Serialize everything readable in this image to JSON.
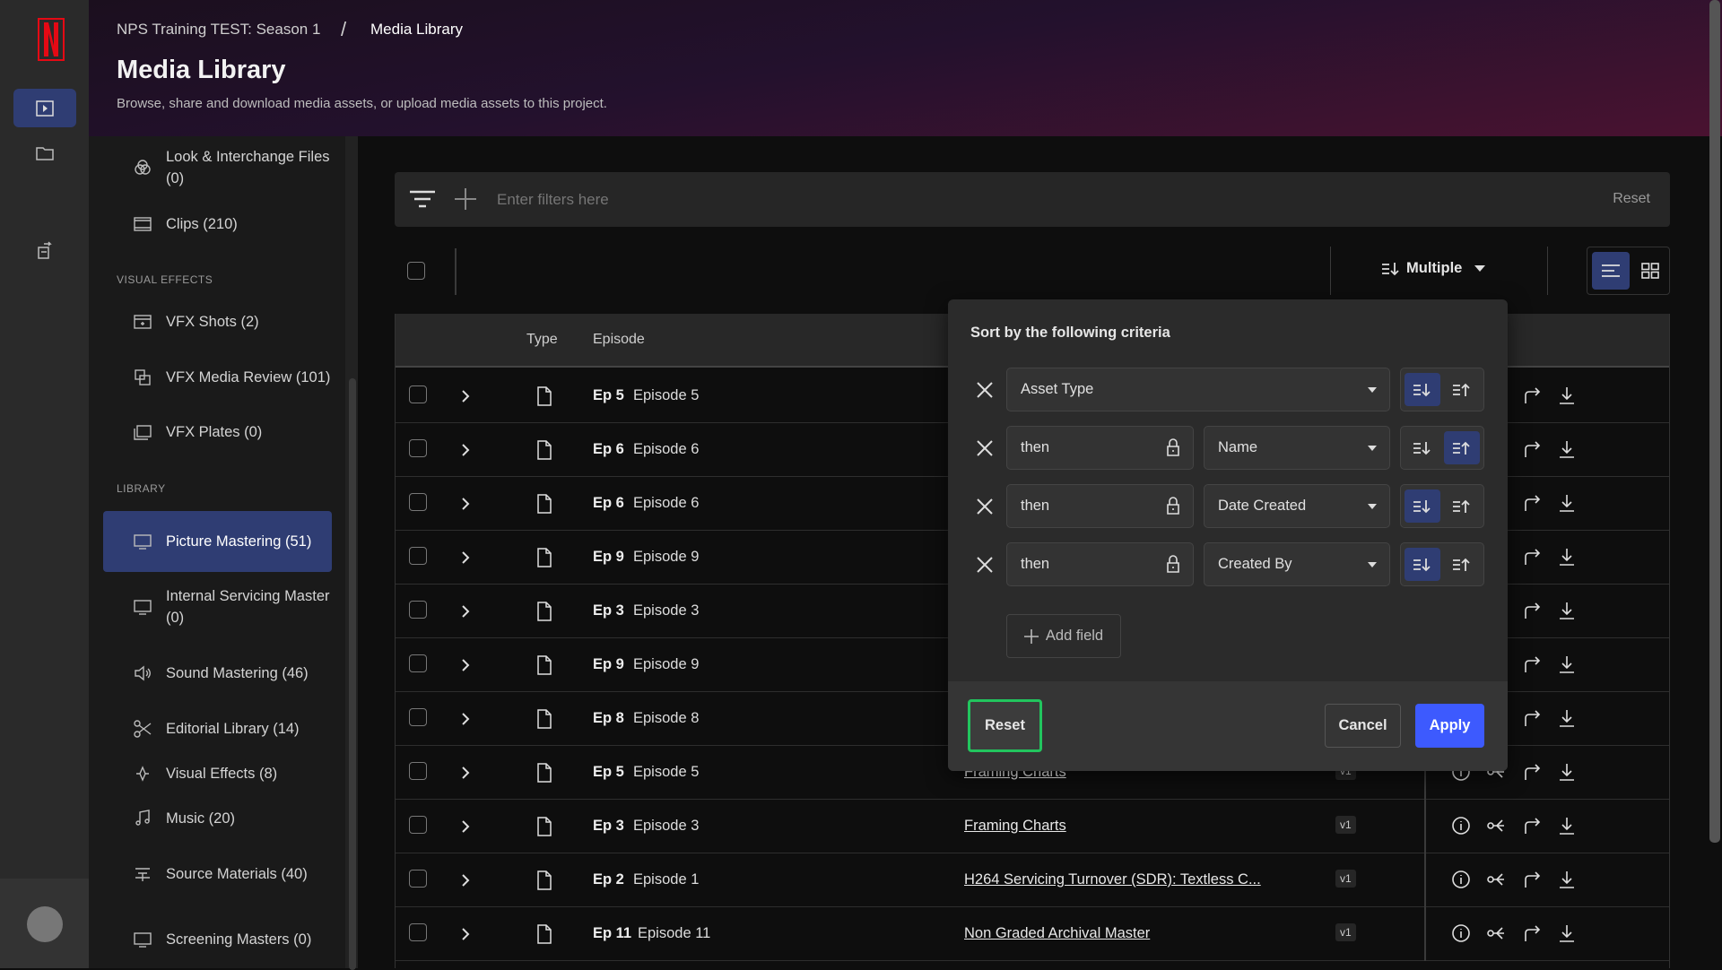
{
  "header": {
    "breadcrumb_parent": "NPS Training TEST: Season 1",
    "breadcrumb_sep": "/",
    "breadcrumb_current": "Media Library",
    "title": "Media Library",
    "subtitle": "Browse, share and download media assets, or upload media assets to this project."
  },
  "colors": {
    "accent": "#2f3d73",
    "apply": "#3d5afe",
    "focus_outline": "#22c55e",
    "brand": "#e50914"
  },
  "rail": {
    "items": [
      {
        "icon": "play-icon",
        "active": true
      },
      {
        "icon": "folder-icon"
      },
      {
        "icon": "export-icon"
      }
    ],
    "avatar": "avatar"
  },
  "sidebar": {
    "items": [
      {
        "label": "Look & Interchange Files (0)",
        "icon": "venn-icon",
        "type": "item"
      },
      {
        "label": "Clips (210)",
        "icon": "film-icon",
        "type": "item"
      },
      {
        "label": "VISUAL EFFECTS",
        "type": "section"
      },
      {
        "label": "VFX Shots (2)",
        "icon": "clapper-icon",
        "type": "item"
      },
      {
        "label": "VFX Media Review (101)",
        "icon": "review-icon",
        "type": "item"
      },
      {
        "label": "VFX Plates (0)",
        "icon": "plates-icon",
        "type": "item"
      },
      {
        "label": "LIBRARY",
        "type": "section"
      },
      {
        "label": "Picture Mastering (51)",
        "icon": "monitor-icon",
        "type": "item",
        "active": true
      },
      {
        "label": "Internal Servicing Master (0)",
        "icon": "monitor-icon",
        "type": "item"
      },
      {
        "label": "Sound Mastering (46)",
        "icon": "speaker-icon",
        "type": "item"
      },
      {
        "label": "Editorial Library (14)",
        "icon": "scissors-icon",
        "type": "item"
      },
      {
        "label": "Visual Effects (8)",
        "icon": "sparkle-icon",
        "type": "item"
      },
      {
        "label": "Music (20)",
        "icon": "music-icon",
        "type": "item"
      },
      {
        "label": "Source Materials (40)",
        "icon": "source-icon",
        "type": "item"
      },
      {
        "label": "Screening Masters (0)",
        "icon": "monitor-icon",
        "type": "item"
      }
    ]
  },
  "filter": {
    "placeholder": "Enter filters here",
    "reset": "Reset"
  },
  "toolbar": {
    "sort_label": "Multiple",
    "view": "list"
  },
  "table": {
    "headers": {
      "type": "Type",
      "episode": "Episode"
    },
    "rows": [
      {
        "ep": "Ep 5",
        "episode": "Episode 5",
        "name": "",
        "version": ""
      },
      {
        "ep": "Ep 6",
        "episode": "Episode 6",
        "name": "",
        "version": ""
      },
      {
        "ep": "Ep 6",
        "episode": "Episode 6",
        "name": "",
        "version": ""
      },
      {
        "ep": "Ep 9",
        "episode": "Episode 9",
        "name": "",
        "version": ""
      },
      {
        "ep": "Ep 3",
        "episode": "Episode 3",
        "name": "",
        "version": ""
      },
      {
        "ep": "Ep 9",
        "episode": "Episode 9",
        "name": "",
        "version": ""
      },
      {
        "ep": "Ep 8",
        "episode": "Episode 8",
        "name": "",
        "version": ""
      },
      {
        "ep": "Ep 5",
        "episode": "Episode 5",
        "name": "Framing Charts",
        "version": "v1"
      },
      {
        "ep": "Ep 3",
        "episode": "Episode 3",
        "name": "Framing Charts",
        "version": "v1"
      },
      {
        "ep": "Ep 2",
        "episode": "Episode 1",
        "name": "H264 Servicing Turnover (SDR): Textless C...",
        "version": "v1"
      },
      {
        "ep": "Ep 11",
        "episode": "Episode 11",
        "name": "Non Graded Archival Master",
        "version": "v1"
      }
    ]
  },
  "sort_popup": {
    "title": "Sort by the following criteria",
    "criteria": [
      {
        "prefix": "",
        "field": "Asset Type",
        "direction": "descending"
      },
      {
        "prefix": "then",
        "field": "Name",
        "direction": "ascending"
      },
      {
        "prefix": "then",
        "field": "Date Created",
        "direction": "descending"
      },
      {
        "prefix": "then",
        "field": "Created By",
        "direction": "descending"
      }
    ],
    "add_field": "Add field",
    "reset": "Reset",
    "cancel": "Cancel",
    "apply": "Apply"
  }
}
